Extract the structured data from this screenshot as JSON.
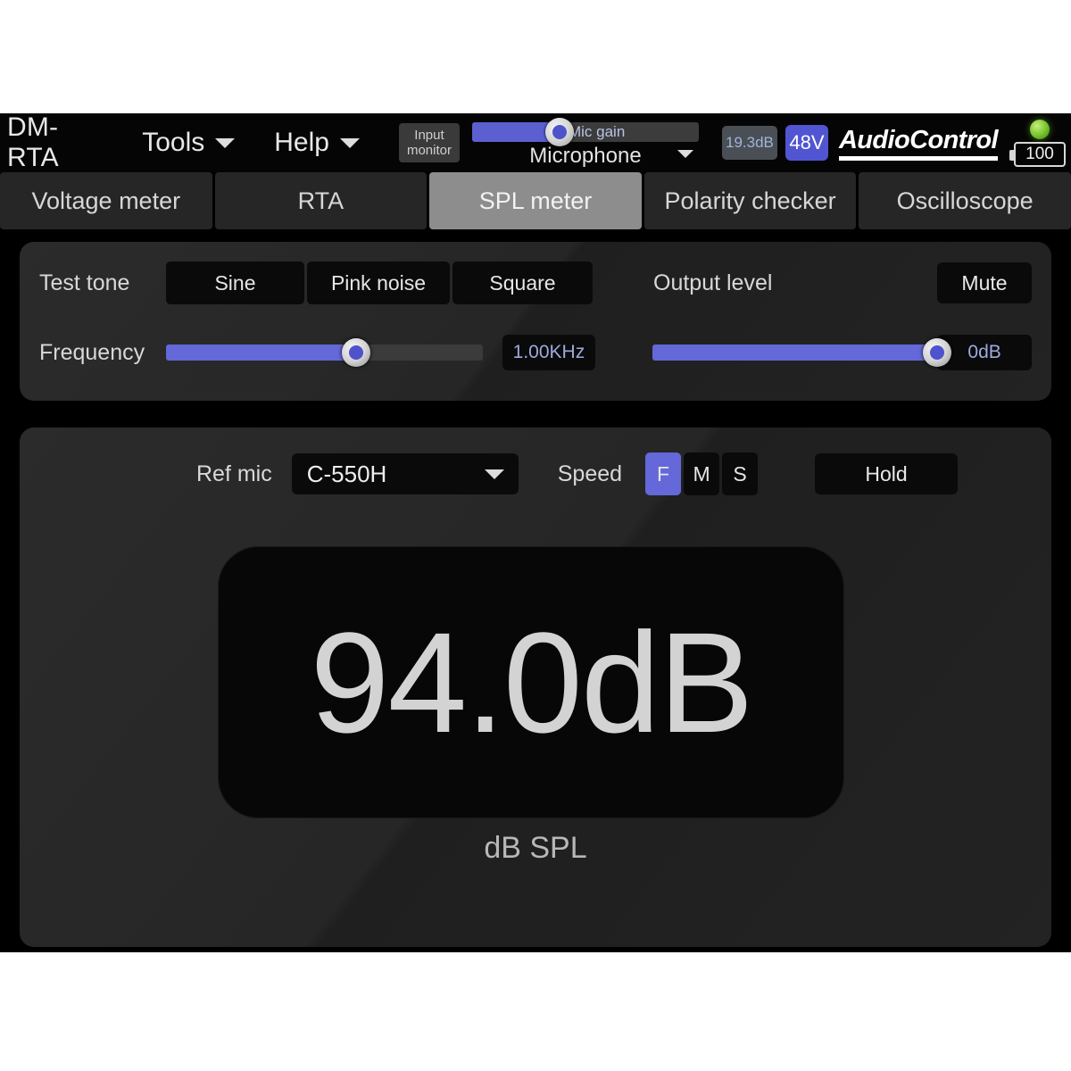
{
  "app": {
    "title": "DM-RTA",
    "brand": "AudioControl"
  },
  "menubar": {
    "menus": [
      {
        "label": "Tools",
        "icon": "chevron-down-icon"
      },
      {
        "label": "Help",
        "icon": "chevron-down-icon"
      }
    ],
    "input_monitor": {
      "line1": "Input",
      "line2": "monitor"
    },
    "mic_gain": {
      "label": "Mic gain",
      "value_percent": 36
    },
    "mic_source": {
      "value": "Microphone"
    },
    "gain_readout": "19.3dB",
    "phantom_power": "48V",
    "battery": "100",
    "led": "power-led"
  },
  "tabs": [
    {
      "label": "Voltage meter",
      "active": false
    },
    {
      "label": "RTA",
      "active": false
    },
    {
      "label": "SPL meter",
      "active": true
    },
    {
      "label": "Polarity checker",
      "active": false
    },
    {
      "label": "Oscilloscope",
      "active": false
    }
  ],
  "test_tone": {
    "label": "Test tone",
    "options": [
      "Sine",
      "Pink noise",
      "Square"
    ],
    "frequency_label": "Frequency",
    "frequency_percent": 60,
    "frequency_value": "1.00KHz"
  },
  "output": {
    "label": "Output level",
    "mute_label": "Mute",
    "level_percent": 100,
    "level_value": "0dB"
  },
  "spl": {
    "ref_mic_label": "Ref mic",
    "ref_mic_value": "C-550H",
    "speed_label": "Speed",
    "speed_options": [
      "F",
      "M",
      "S"
    ],
    "speed_selected": "F",
    "hold_label": "Hold",
    "value": "94.0dB",
    "units": "dB SPL"
  },
  "colors": {
    "accent": "#5b5fd0",
    "slider_fill": "#6468d8",
    "tab_active": "#8d8d8d",
    "led_green": "#72c22a"
  }
}
